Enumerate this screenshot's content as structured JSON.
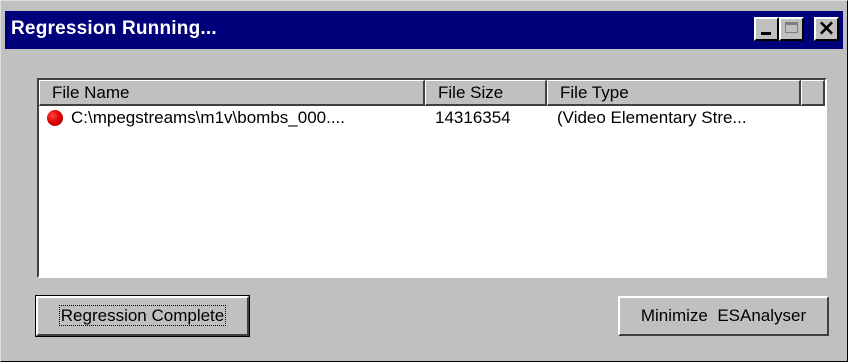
{
  "window": {
    "title": "Regression Running...",
    "controls": {
      "minimize_icon": "minimize-icon",
      "maximize_icon": "maximize-icon",
      "close_glyph": "×"
    }
  },
  "list": {
    "columns": [
      "File Name",
      "File Size",
      "File Type",
      ""
    ],
    "rows": [
      {
        "status": "error",
        "status_color": "#e00000",
        "name": "C:\\mpegstreams\\m1v\\bombs_000....",
        "size": "14316354",
        "type": "(Video Elementary Stre..."
      }
    ]
  },
  "buttons": {
    "regression_complete": "Regression Complete",
    "minimize_app": "Minimize  ESAnalyser"
  },
  "colors": {
    "titlebar": "#00007b",
    "face": "#c0c0c0",
    "status_dot": "#e00000"
  }
}
